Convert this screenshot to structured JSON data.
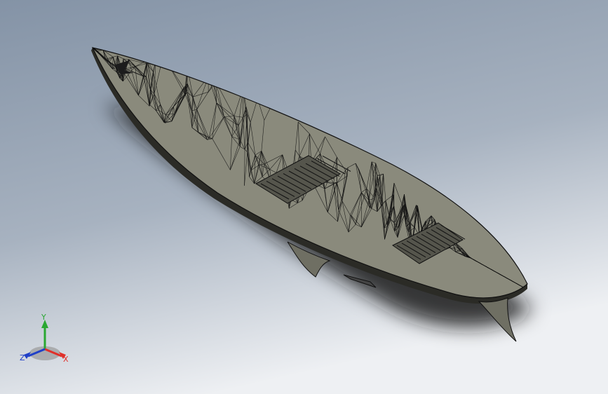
{
  "viewport": {
    "background_top": "#8493a6",
    "background_bottom": "#eef0f3",
    "model": "surfboard-mesh",
    "display_style": "shaded-with-edges"
  },
  "model_colors": {
    "face": "#8a8a7c",
    "face_dark": "#6f6f63",
    "edge": "#111111",
    "shadow": "#1a1a1a"
  },
  "triad": {
    "x_label": "X",
    "y_label": "Y",
    "z_label": "Z",
    "x_color": "#e0302a",
    "y_color": "#2aa832",
    "z_color": "#2040c8"
  }
}
